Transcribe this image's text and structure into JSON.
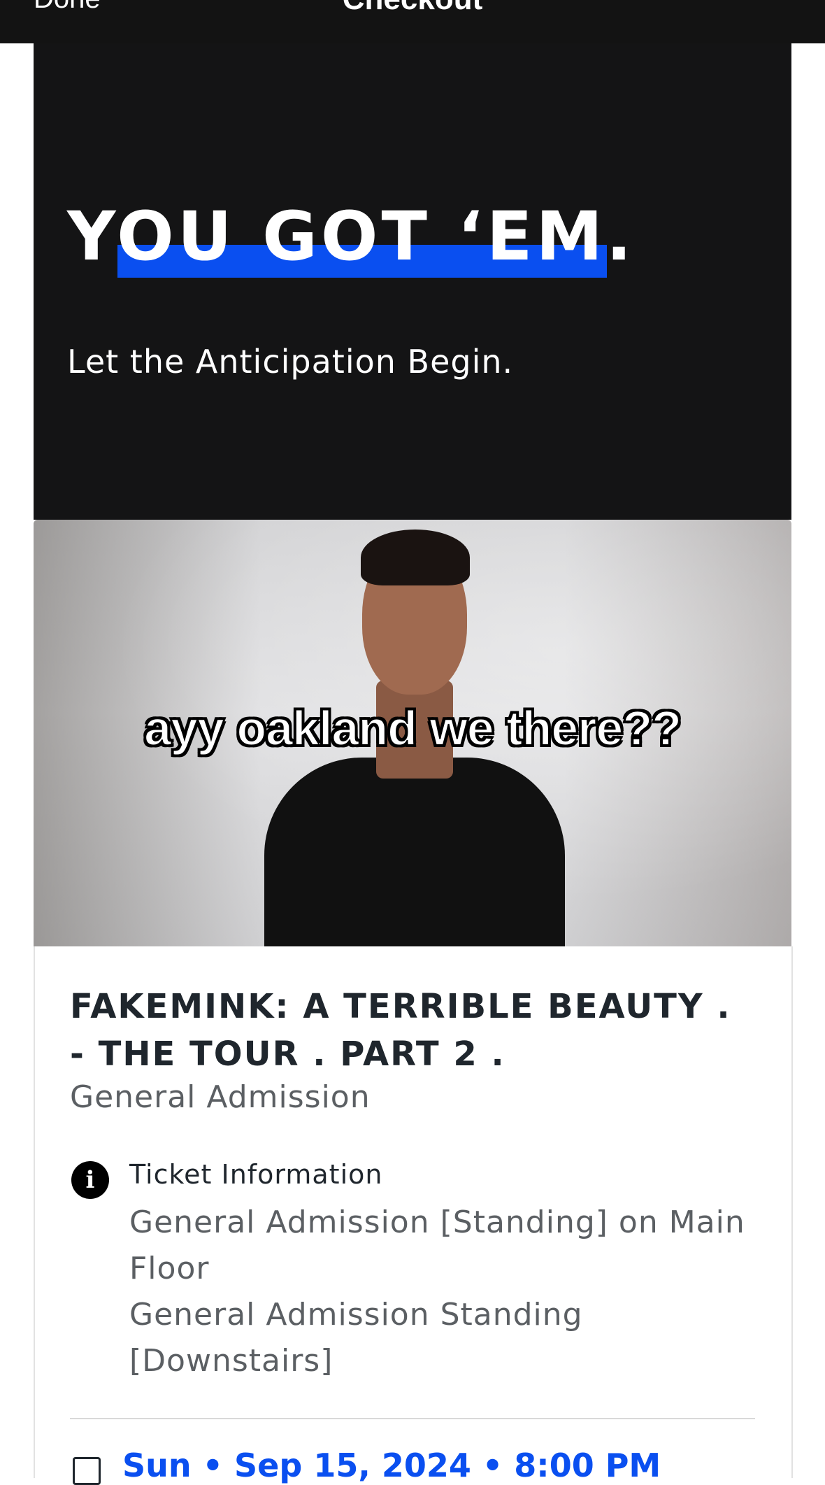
{
  "nav": {
    "done_label": "Done",
    "title": "Checkout"
  },
  "hero": {
    "headline": "YOU GOT ‘EM.",
    "subtitle": "Let the Anticipation Begin.",
    "highlight_color": "#0a4ff0",
    "background_color": "#141415"
  },
  "media": {
    "caption": "ayy oakland we there??"
  },
  "event": {
    "title": "FAKEMINK: A TERRIBLE BEAUTY . - THE TOUR . PART 2 .",
    "ticket_type": "General Admission"
  },
  "ticket_info": {
    "icon": "info-icon",
    "label": "Ticket Information",
    "lines": [
      "General Admission [Standing] on Main Floor",
      "General Admission Standing [Downstairs]"
    ]
  },
  "date": {
    "icon": "calendar-icon",
    "text": "Sun • Sep 15, 2024 • 8:00 PM"
  }
}
